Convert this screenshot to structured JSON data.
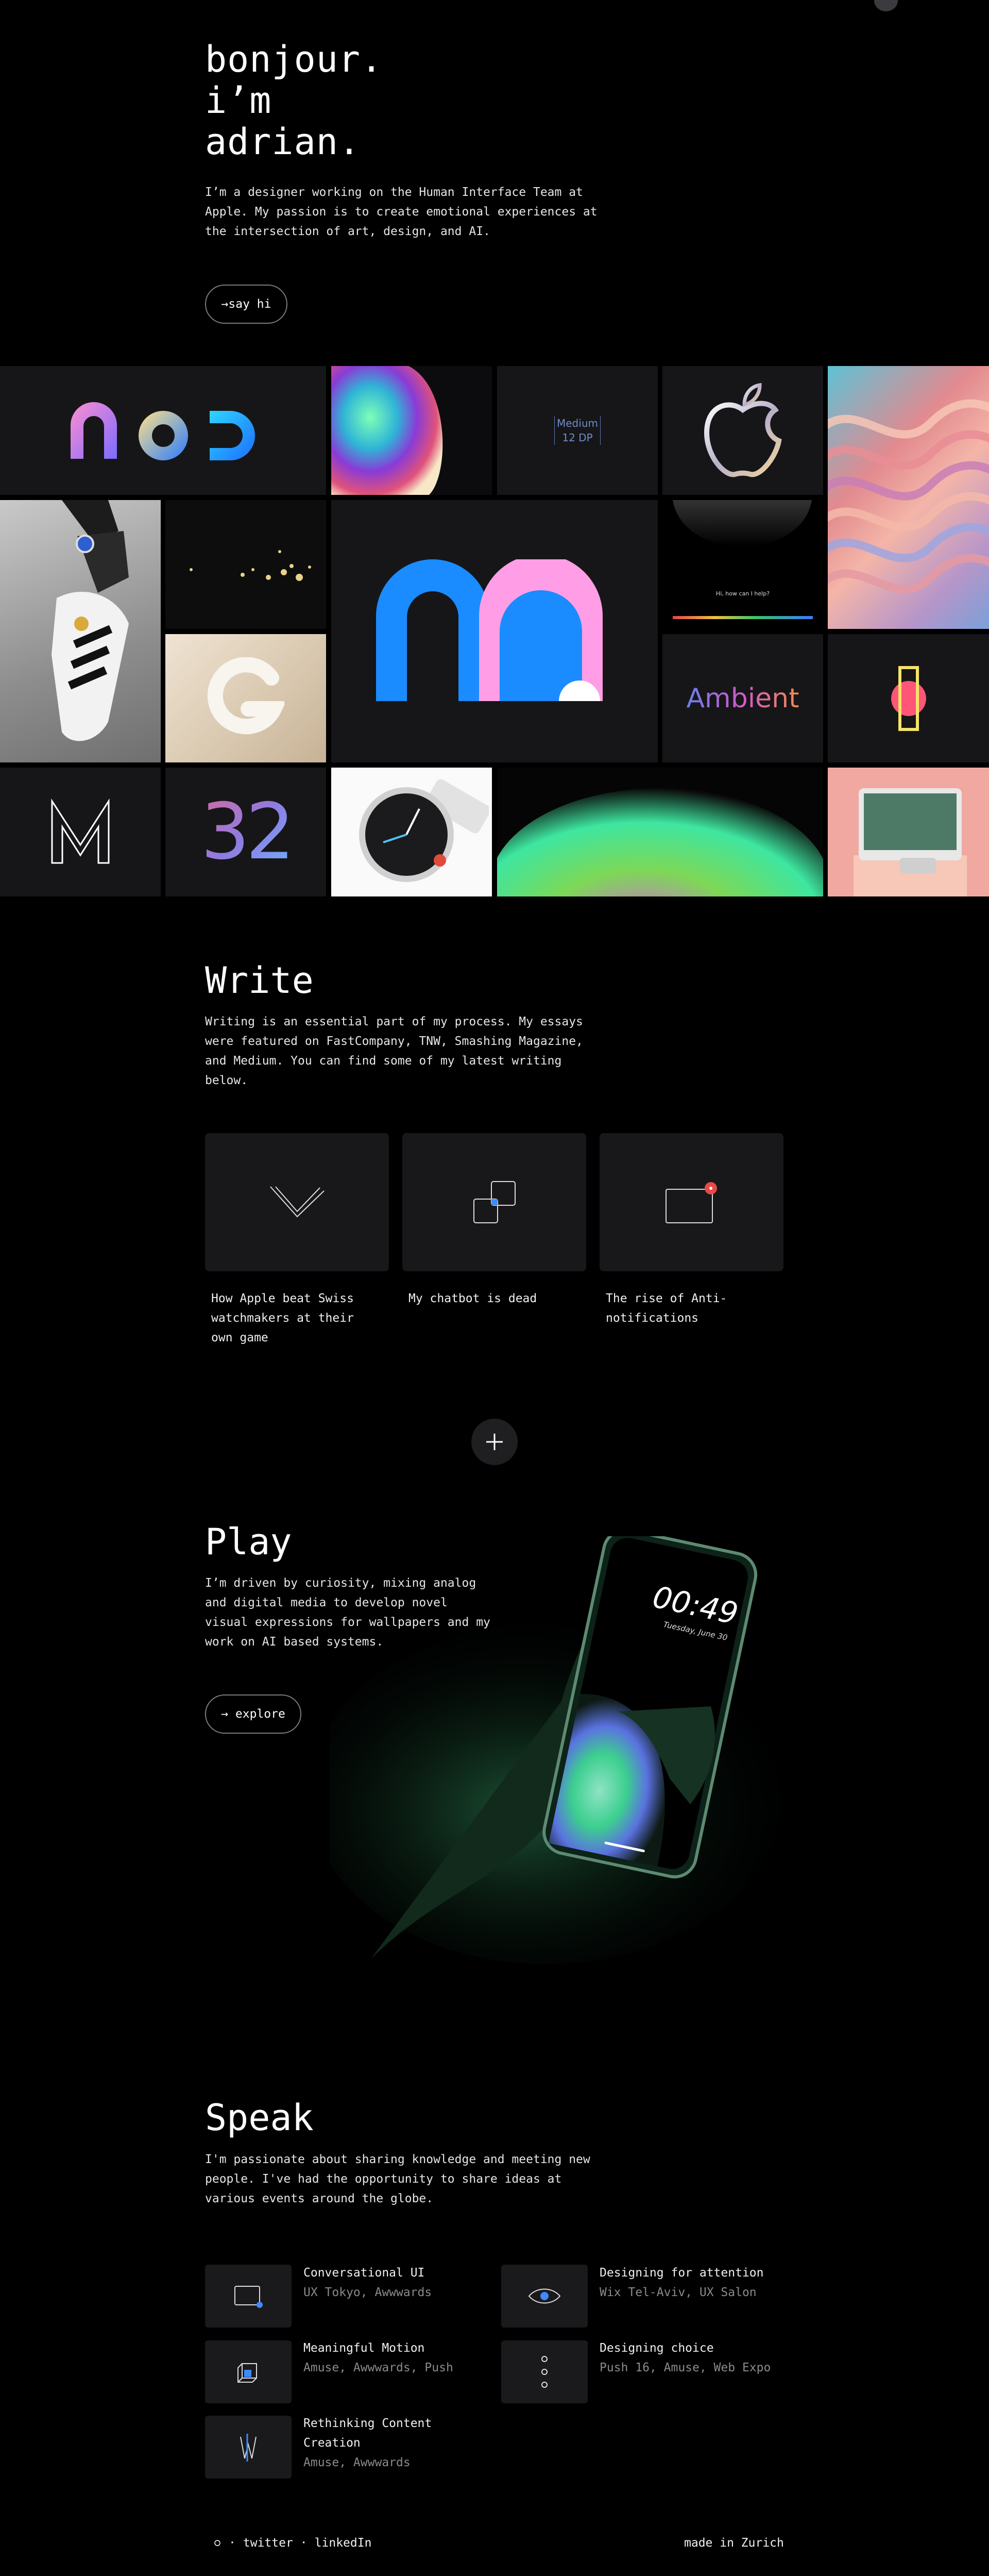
{
  "hero": {
    "title_lines": [
      "bonjour.",
      "i’m",
      "adrian."
    ],
    "description": "I’m a designer working on the Human Interface Team at Apple. My passion is to create emotional experiences at the intersection of art, design, and AI.",
    "cta_label": "→say hi"
  },
  "portfolio": {
    "medium_tile_line1": "Medium",
    "medium_tile_line2": "12 DP",
    "siri_prompt": "Hi, how can I help?",
    "ambient_label": "Ambient",
    "number_label": "32"
  },
  "write": {
    "title": "Write",
    "description": "Writing is an essential part of my process. My essays were featured on FastCompany, TNW, Smashing Magazine, and Medium. You can find some of my latest writing below.",
    "articles": [
      {
        "title": "How Apple beat Swiss watchmakers at their own game",
        "icon": "checkmark-icon"
      },
      {
        "title": "My chatbot is dead",
        "icon": "overlapping-squares-icon"
      },
      {
        "title": "The rise of Anti-notifications",
        "icon": "notification-badge-icon"
      }
    ],
    "more_icon": "plus-icon"
  },
  "play": {
    "title": "Play",
    "description": "I’m driven by curiosity, mixing analog and digital media to develop novel visual expressions for wallpapers and my work on AI based systems.",
    "cta_label": "→ explore",
    "phone_time": "00:49",
    "phone_date": "Tuesday, June 30"
  },
  "speak": {
    "title": "Speak",
    "description": "I'm passionate about sharing knowledge and meeting new people. I've had the opportunity to share ideas at various events around the globe.",
    "talks": [
      {
        "title": "Conversational UI",
        "events": "UX Tokyo, Awwwards",
        "icon": "chat-window-icon"
      },
      {
        "title": "Designing for attention",
        "events": "Wix Tel-Aviv, UX Salon",
        "icon": "eye-icon"
      },
      {
        "title": "Meaningful Motion",
        "events": "Amuse, Awwwards, Push",
        "icon": "cube-icon"
      },
      {
        "title": "Designing choice",
        "events": "Push 16, Amuse, Web Expo",
        "icon": "three-dots-icon"
      },
      {
        "title": "Rethinking Content Creation",
        "events": "Amuse, Awwwards",
        "icon": "w-letter-icon"
      }
    ]
  },
  "footer": {
    "home_icon": "home-icon",
    "separator": "·",
    "twitter": "twitter",
    "linkedin": "linkedIn",
    "made_in": "made in Zurich"
  }
}
